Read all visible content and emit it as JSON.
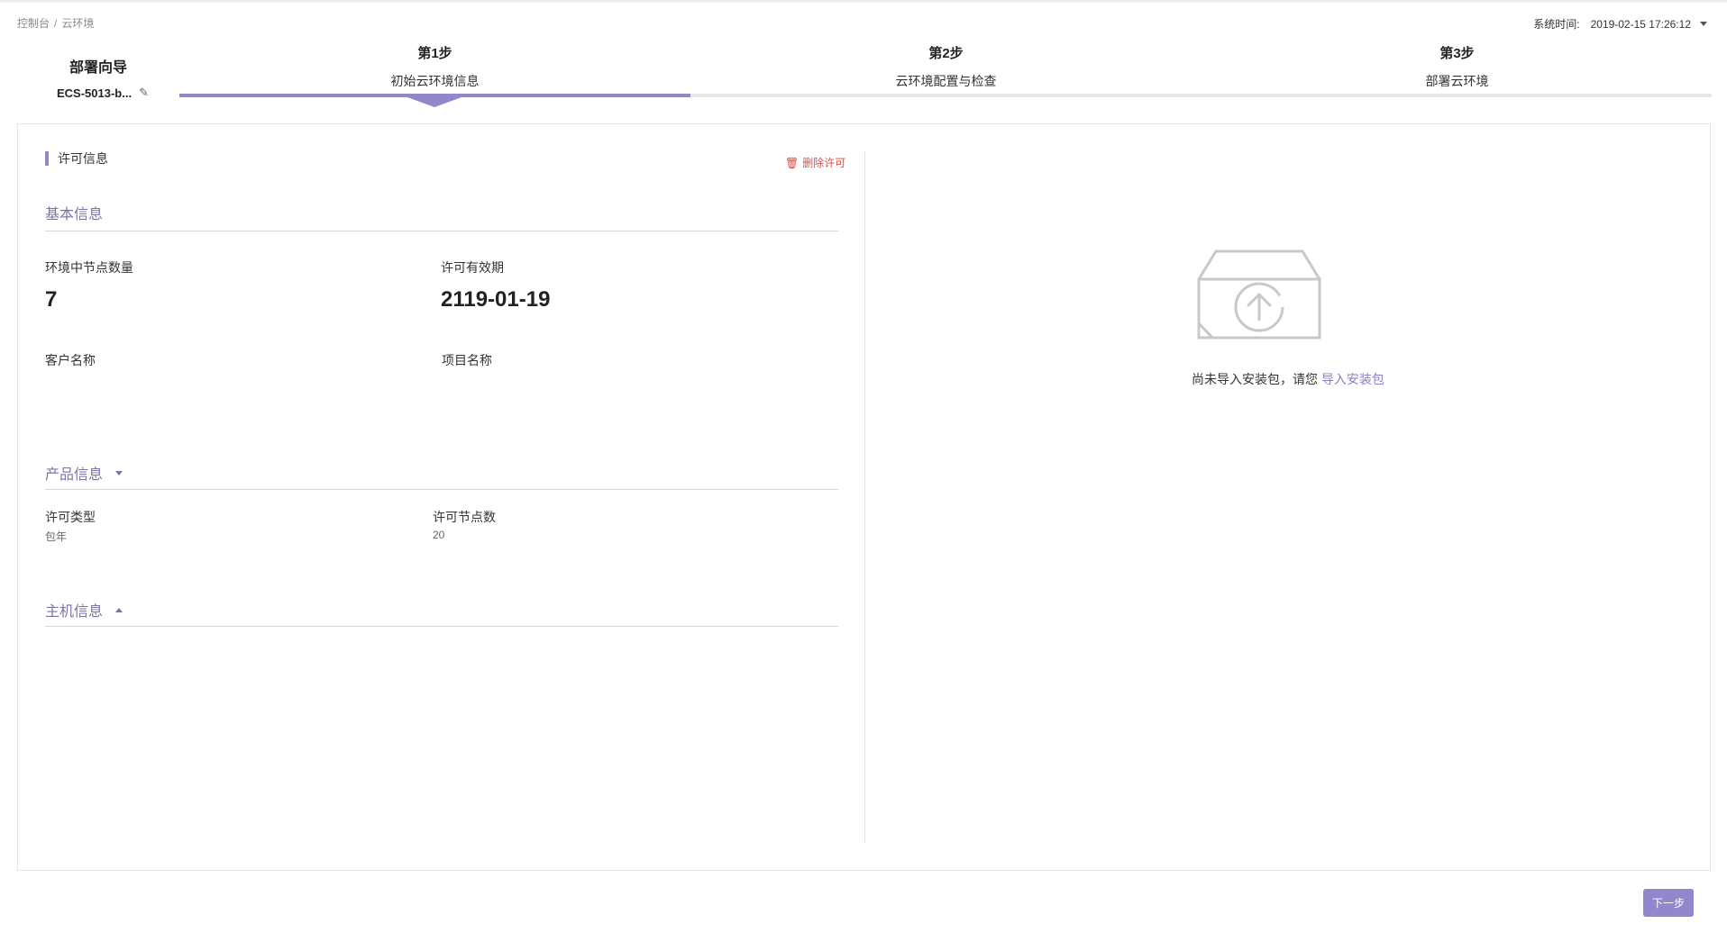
{
  "breadcrumb": {
    "items": [
      "控制台",
      "云环境"
    ],
    "separator": "/"
  },
  "system_time": {
    "label": "系统时间:",
    "value": "2019-02-15 17:26:12"
  },
  "wizard": {
    "title": "部署向导",
    "env_name": "ECS-5013-b..."
  },
  "steps": [
    {
      "num": "第1步",
      "desc": "初始云环境信息"
    },
    {
      "num": "第2步",
      "desc": "云环境配置与检查"
    },
    {
      "num": "第3步",
      "desc": "部署云环境"
    }
  ],
  "progress": {
    "active_step": 1,
    "total_steps": 3
  },
  "license": {
    "section_title": "许可信息",
    "delete_label": "删除许可",
    "basic": {
      "title": "基本信息",
      "node_count_label": "环境中节点数量",
      "node_count_value": "7",
      "expiry_label": "许可有效期",
      "expiry_value": "2119-01-19",
      "customer_label": "客户名称",
      "project_label": "项目名称"
    },
    "product": {
      "title": "产品信息",
      "type_label": "许可类型",
      "type_value": "包年",
      "nodes_label": "许可节点数",
      "nodes_value": "20"
    },
    "host": {
      "title": "主机信息"
    }
  },
  "package": {
    "empty_text": "尚未导入安装包，请您",
    "import_link": "导入安装包",
    "icon": "upload-box-icon"
  },
  "footer": {
    "next_label": "下一步"
  },
  "colors": {
    "accent": "#9286cc",
    "danger": "#e8483f",
    "link": "#8a7fcf"
  }
}
